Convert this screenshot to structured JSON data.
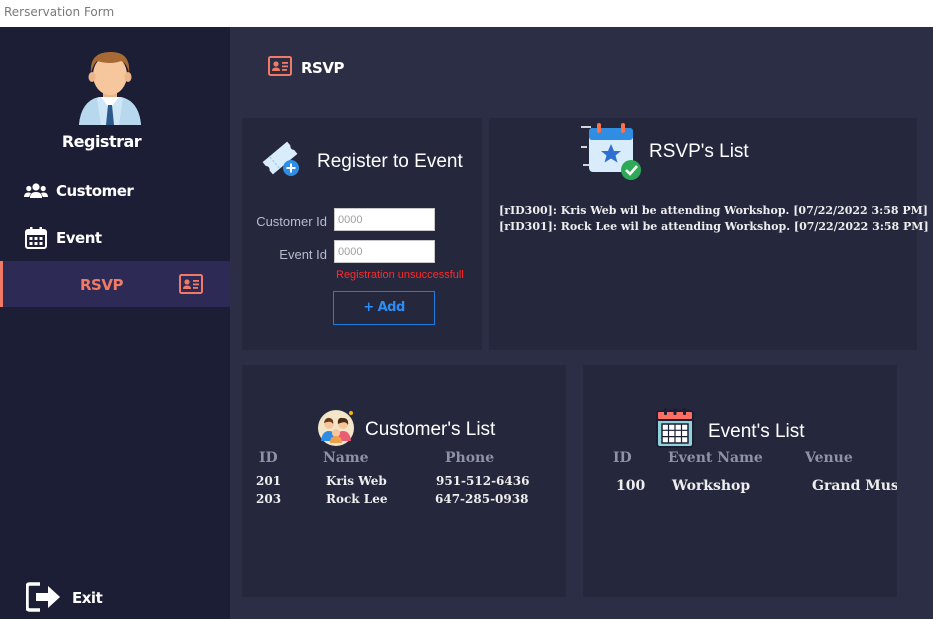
{
  "window": {
    "title": "Rerservation Form"
  },
  "sidebar": {
    "user_label": "Registrar",
    "avatar_icon": "male-user-avatar-icon",
    "items": [
      {
        "label": "Customer",
        "icon": "users-icon"
      },
      {
        "label": "Event",
        "icon": "calendar-icon"
      },
      {
        "label": "RSVP",
        "icon": "id-card-icon",
        "active": true
      }
    ],
    "exit_label": "Exit",
    "exit_icon": "exit-door-icon",
    "accent_color": "#f07a66"
  },
  "header": {
    "title": "RSVP",
    "icon": "id-card-icon"
  },
  "register": {
    "title": "Register to Event",
    "icon": "ticket-add-icon",
    "customer_id_label": "Customer Id",
    "customer_id_placeholder": "0000",
    "event_id_label": "Event Id",
    "event_id_placeholder": "0000",
    "error_message": "Registration unsuccessfull",
    "add_button": "+ Add"
  },
  "rsvp_list": {
    "title": "RSVP's List",
    "icon": "calendar-star-check-icon",
    "entries": [
      "[rID300]: Kris Web wil be attending Workshop. [07/22/2022 3:58 PM]",
      "[rID301]: Rock Lee wil be attending Workshop. [07/22/2022 3:58 PM]"
    ]
  },
  "customers": {
    "title": "Customer's List",
    "icon": "group-people-icon",
    "columns": [
      "ID",
      "Name",
      "Phone"
    ],
    "rows": [
      [
        "201",
        "Kris Web",
        "951-512-6436"
      ],
      [
        "203",
        "Rock Lee",
        "647-285-0938"
      ]
    ]
  },
  "events": {
    "title": "Event's List",
    "icon": "calendar-grid-icon",
    "columns": [
      "ID",
      "Event Name",
      "Venue"
    ],
    "rows": [
      [
        "100",
        "Workshop",
        "Grand Muse"
      ]
    ]
  }
}
